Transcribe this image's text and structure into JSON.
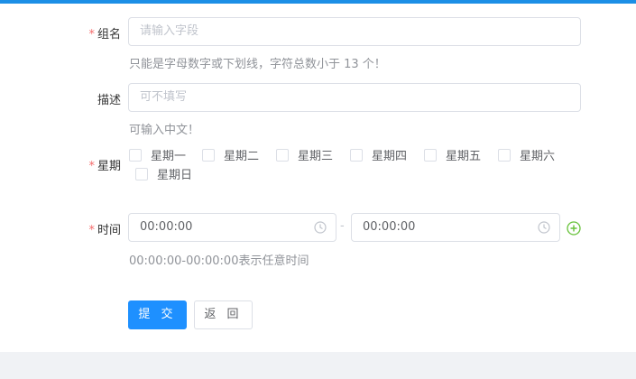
{
  "form": {
    "group_name": {
      "required_mark": "*",
      "label": "组名",
      "placeholder": "请输入字段",
      "hint": "只能是字母数字或下划线，字符总数小于 13 个！"
    },
    "description": {
      "label": "描述",
      "placeholder": "可不填写",
      "hint": "可输入中文！"
    },
    "weekday": {
      "required_mark": "*",
      "label": "星期",
      "options": [
        "星期一",
        "星期二",
        "星期三",
        "星期四",
        "星期五",
        "星期六",
        "星期日"
      ]
    },
    "time": {
      "required_mark": "*",
      "label": "时间",
      "start": "00:00:00",
      "separator": "-",
      "end": "00:00:00",
      "hint": "00:00:00-00:00:00表示任意时间"
    },
    "buttons": {
      "submit": "提 交",
      "back": "返 回"
    }
  },
  "colors": {
    "accent": "#1e90ff",
    "required": "#f56c6c",
    "add_icon": "#67c23a"
  }
}
